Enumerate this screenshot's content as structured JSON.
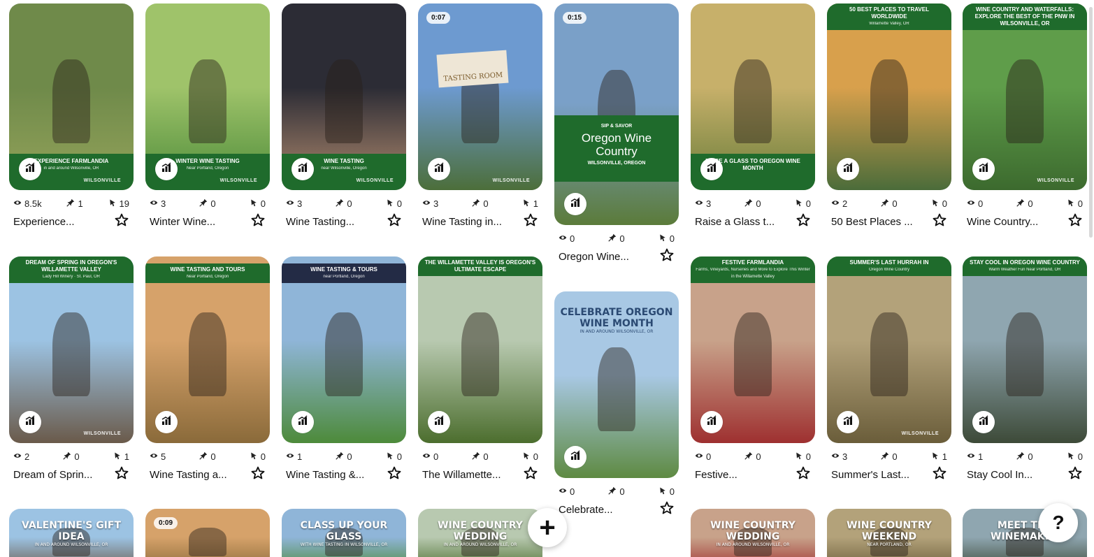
{
  "icons": {
    "views": "eye-icon",
    "saves": "pin-icon",
    "clicks": "click-icon",
    "stats": "bar-chart-icon",
    "favorite": "star-outline-icon",
    "add": "plus-icon",
    "help": "question-mark-icon"
  },
  "colors": {
    "banner_green": "#1f6b2c",
    "banner_navy": "#232b45"
  },
  "columns": [
    [
      {
        "title": "Experience...",
        "views": "8.5k",
        "saves": "1",
        "clicks": "19",
        "overlay": {
          "banner": "EXPERIENCE FARMLANDIA",
          "sub": "in and around Wilsonville, OR",
          "brand": "WILSONVILLE"
        }
      },
      {
        "title": "Dream of Sprin...",
        "views": "2",
        "saves": "0",
        "clicks": "1",
        "overlay": {
          "banner": "DREAM OF SPRING IN OREGON'S WILLAMETTE VALLEY",
          "sub": "Lady Hill Winery · St. Paul, OR",
          "brand": "WILSONVILLE"
        }
      },
      {
        "overlay": {
          "big": "VALENTINE'S GIFT IDEA",
          "sub": "in and around Wilsonville, OR"
        }
      }
    ],
    [
      {
        "title": "Winter Wine...",
        "views": "3",
        "saves": "0",
        "clicks": "0",
        "overlay": {
          "banner": "WINTER WINE TASTING",
          "sub": "Near Portland, Oregon",
          "brand": "WILSONVILLE"
        }
      },
      {
        "title": "Wine Tasting a...",
        "views": "5",
        "saves": "0",
        "clicks": "0",
        "overlay": {
          "banner": "WINE TASTING AND TOURS",
          "sub": "Near Portland, Oregon",
          "brand": ""
        }
      },
      {
        "overlay": {
          "duration": "0:09"
        }
      }
    ],
    [
      {
        "title": "Wine Tasting...",
        "views": "3",
        "saves": "0",
        "clicks": "0",
        "overlay": {
          "banner": "WINE TASTING",
          "sub": "near Wilsonville, Oregon",
          "brand": "WILSONVILLE"
        }
      },
      {
        "title": "Wine Tasting &...",
        "views": "1",
        "saves": "0",
        "clicks": "0",
        "overlay": {
          "banner": "WINE TASTING & TOURS",
          "sub": "near Portland, Oregon",
          "brand": ""
        }
      },
      {
        "overlay": {
          "big": "CLASS UP YOUR GLASS",
          "sub": "with wine tasting in Wilsonville, OR"
        }
      }
    ],
    [
      {
        "title": "Wine Tasting in...",
        "views": "3",
        "saves": "0",
        "clicks": "1",
        "overlay": {
          "duration": "0:07",
          "sign": "TASTING ROOM",
          "brand": "WILSONVILLE"
        }
      },
      {
        "title": "The Willamette...",
        "views": "0",
        "saves": "0",
        "clicks": "0",
        "overlay": {
          "banner": "THE WILLAMETTE VALLEY IS OREGON'S ULTIMATE ESCAPE",
          "sub": "",
          "brand": ""
        }
      },
      {
        "overlay": {
          "big": "WINE COUNTRY WEDDING",
          "sub": "in and around Wilsonville, OR"
        }
      }
    ],
    [
      {
        "title": "Oregon Wine...",
        "views": "0",
        "saves": "0",
        "clicks": "0",
        "overlay": {
          "duration": "0:15",
          "kicker": "SIP & SAVOR",
          "headline": "Oregon Wine Country",
          "sub": "WILSONVILLE, OREGON"
        }
      },
      {
        "title": "Celebrate...",
        "views": "0",
        "saves": "0",
        "clicks": "0",
        "overlay": {
          "big": "CELEBRATE OREGON WINE MONTH",
          "sub": "in and around Wilsonville, OR"
        }
      }
    ],
    [
      {
        "title": "Raise a Glass t...",
        "views": "3",
        "saves": "0",
        "clicks": "0",
        "overlay": {
          "banner": "RAISE A GLASS TO OREGON WINE MONTH",
          "sub": "",
          "brand": ""
        }
      },
      {
        "title": "Festive...",
        "views": "0",
        "saves": "0",
        "clicks": "0",
        "overlay": {
          "banner": "FESTIVE FARMLANDIA",
          "sub": "Farms, Vineyards, Nurseries and More to Explore This Winter in the Willamette Valley",
          "brand": ""
        }
      },
      {
        "overlay": {
          "big": "WINE COUNTRY WEDDING",
          "sub": "in and around Wilsonville, OR"
        }
      }
    ],
    [
      {
        "title": "50 Best Places ...",
        "views": "2",
        "saves": "0",
        "clicks": "0",
        "overlay": {
          "banner": "50 BEST PLACES TO TRAVEL WORLDWIDE",
          "sub": "Willamette Valley, OR",
          "brand": ""
        }
      },
      {
        "title": "Summer's Last...",
        "views": "3",
        "saves": "0",
        "clicks": "1",
        "overlay": {
          "banner": "SUMMER'S LAST HURRAH IN",
          "sub": "Oregon Wine Country",
          "brand": "WILSONVILLE"
        }
      },
      {
        "overlay": {
          "big": "WINE COUNTRY WEEKEND",
          "sub": "near Portland, OR"
        }
      }
    ],
    [
      {
        "title": "Wine Country...",
        "views": "0",
        "saves": "0",
        "clicks": "0",
        "overlay": {
          "banner": "WINE COUNTRY AND WATERFALLS: EXPLORE THE BEST OF THE PNW IN WILSONVILLE, OR",
          "sub": "",
          "brand": "WILSONVILLE"
        }
      },
      {
        "title": "Stay Cool In...",
        "views": "1",
        "saves": "0",
        "clicks": "0",
        "overlay": {
          "banner": "STAY COOL IN OREGON WINE COUNTRY",
          "sub": "Warm Weather Fun Near Portland, OR",
          "brand": ""
        }
      },
      {
        "overlay": {
          "big": "MEET THE WINEMAKER",
          "sub": ""
        }
      }
    ]
  ]
}
